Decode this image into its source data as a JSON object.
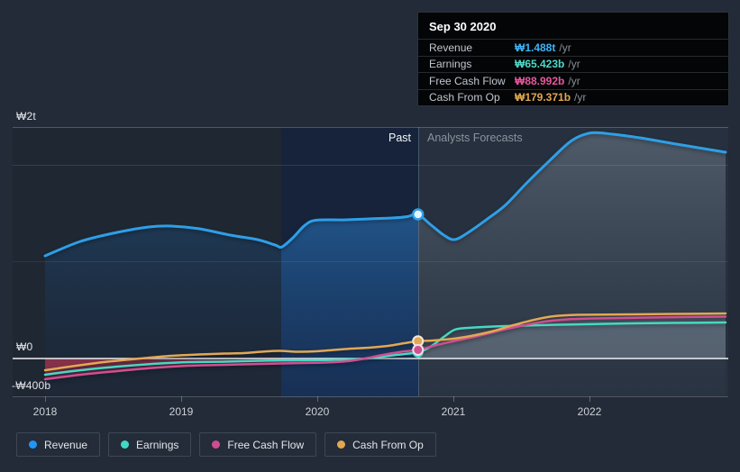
{
  "tooltip": {
    "date": "Sep 30 2020",
    "rows": [
      {
        "label": "Revenue",
        "value": "₩1.488t",
        "suffix": "/yr",
        "color": "#3fb3f6"
      },
      {
        "label": "Earnings",
        "value": "₩65.423b",
        "suffix": "/yr",
        "color": "#4fd9c6"
      },
      {
        "label": "Free Cash Flow",
        "value": "₩88.992b",
        "suffix": "/yr",
        "color": "#e8579d"
      },
      {
        "label": "Cash From Op",
        "value": "₩179.371b",
        "suffix": "/yr",
        "color": "#e2a84f"
      }
    ]
  },
  "labels": {
    "past": "Past",
    "forecast": "Analysts Forecasts"
  },
  "y_axis": {
    "top": "₩2t",
    "zero": "₩0",
    "bottom": "-₩400b"
  },
  "x_axis": [
    "2018",
    "2019",
    "2020",
    "2021",
    "2022"
  ],
  "legend": [
    {
      "label": "Revenue",
      "color": "#2196f3"
    },
    {
      "label": "Earnings",
      "color": "#40d9c4"
    },
    {
      "label": "Free Cash Flow",
      "color": "#cf4d8e"
    },
    {
      "label": "Cash From Op",
      "color": "#e0a852"
    }
  ],
  "chart_data": {
    "type": "line",
    "title": "",
    "x_unit": "year",
    "y_unit": "KRW billions",
    "ylim_b": [
      -400,
      2400
    ],
    "gridlines_b": [
      2000,
      1000,
      0,
      -400
    ],
    "x_ticks": [
      2018,
      2019,
      2020,
      2021,
      2022
    ],
    "past_until_year": 2020.74,
    "highlight_band_years": [
      2019.74,
      2020.74
    ],
    "legend_position": "bottom",
    "marker": {
      "year": 2020.74,
      "values_b": {
        "Revenue": 1488,
        "Earnings": 65.423,
        "Free Cash Flow": 88.992,
        "Cash From Op": 179.371
      }
    },
    "series": [
      {
        "name": "Revenue",
        "color": "#2e9fe6",
        "points": [
          [
            2018.0,
            1060
          ],
          [
            2018.26,
            1209
          ],
          [
            2018.53,
            1302
          ],
          [
            2018.76,
            1358
          ],
          [
            2018.93,
            1367
          ],
          [
            2019.13,
            1340
          ],
          [
            2019.36,
            1274
          ],
          [
            2019.56,
            1228
          ],
          [
            2019.69,
            1172
          ],
          [
            2019.74,
            1153
          ],
          [
            2019.82,
            1246
          ],
          [
            2019.91,
            1377
          ],
          [
            2019.99,
            1428
          ],
          [
            2020.19,
            1432
          ],
          [
            2020.38,
            1442
          ],
          [
            2020.55,
            1451
          ],
          [
            2020.66,
            1465
          ],
          [
            2020.74,
            1488
          ],
          [
            2020.83,
            1386
          ],
          [
            2020.93,
            1274
          ],
          [
            2021.01,
            1228
          ],
          [
            2021.11,
            1302
          ],
          [
            2021.25,
            1442
          ],
          [
            2021.38,
            1581
          ],
          [
            2021.54,
            1814
          ],
          [
            2021.71,
            2047
          ],
          [
            2021.87,
            2251
          ],
          [
            2022.01,
            2330
          ],
          [
            2022.17,
            2316
          ],
          [
            2022.37,
            2279
          ],
          [
            2022.64,
            2214
          ],
          [
            2023.0,
            2130
          ]
        ]
      },
      {
        "name": "Earnings",
        "color": "#46d8c3",
        "points": [
          [
            2018.0,
            -167
          ],
          [
            2018.26,
            -121
          ],
          [
            2018.53,
            -84
          ],
          [
            2018.79,
            -56
          ],
          [
            2019.06,
            -37
          ],
          [
            2019.32,
            -33
          ],
          [
            2019.59,
            -23
          ],
          [
            2019.85,
            -19
          ],
          [
            2020.12,
            -14
          ],
          [
            2020.32,
            -5
          ],
          [
            2020.45,
            14
          ],
          [
            2020.58,
            37
          ],
          [
            2020.74,
            65.4
          ],
          [
            2020.83,
            121
          ],
          [
            2020.93,
            223
          ],
          [
            2021.01,
            298
          ],
          [
            2021.11,
            316
          ],
          [
            2021.38,
            335
          ],
          [
            2021.77,
            349
          ],
          [
            2022.3,
            363
          ],
          [
            2023.0,
            372
          ]
        ]
      },
      {
        "name": "Free Cash Flow",
        "color": "#cf4f90",
        "points": [
          [
            2018.0,
            -214
          ],
          [
            2018.26,
            -167
          ],
          [
            2018.53,
            -130
          ],
          [
            2018.79,
            -98
          ],
          [
            2019.06,
            -74
          ],
          [
            2019.32,
            -65
          ],
          [
            2019.59,
            -56
          ],
          [
            2019.85,
            -47
          ],
          [
            2020.05,
            -42
          ],
          [
            2020.22,
            -28
          ],
          [
            2020.35,
            0
          ],
          [
            2020.48,
            37
          ],
          [
            2020.62,
            70
          ],
          [
            2020.74,
            89
          ],
          [
            2020.88,
            140
          ],
          [
            2021.01,
            181
          ],
          [
            2021.18,
            233
          ],
          [
            2021.34,
            288
          ],
          [
            2021.51,
            340
          ],
          [
            2021.67,
            381
          ],
          [
            2021.84,
            405
          ],
          [
            2022.04,
            414
          ],
          [
            2022.44,
            423
          ],
          [
            2023.0,
            433
          ]
        ]
      },
      {
        "name": "Cash From Op",
        "color": "#e2a854",
        "points": [
          [
            2018.0,
            -121
          ],
          [
            2018.23,
            -74
          ],
          [
            2018.46,
            -33
          ],
          [
            2018.7,
            0
          ],
          [
            2018.93,
            28
          ],
          [
            2019.13,
            42
          ],
          [
            2019.32,
            51
          ],
          [
            2019.46,
            56
          ],
          [
            2019.59,
            70
          ],
          [
            2019.72,
            79
          ],
          [
            2019.85,
            70
          ],
          [
            2019.99,
            74
          ],
          [
            2020.12,
            88
          ],
          [
            2020.25,
            102
          ],
          [
            2020.38,
            112
          ],
          [
            2020.52,
            130
          ],
          [
            2020.64,
            158
          ],
          [
            2020.74,
            179.4
          ],
          [
            2020.85,
            186
          ],
          [
            2021.0,
            205
          ],
          [
            2021.11,
            228
          ],
          [
            2021.28,
            279
          ],
          [
            2021.44,
            344
          ],
          [
            2021.61,
            405
          ],
          [
            2021.74,
            437
          ],
          [
            2021.91,
            451
          ],
          [
            2022.3,
            456
          ],
          [
            2023.0,
            465
          ]
        ]
      }
    ]
  }
}
